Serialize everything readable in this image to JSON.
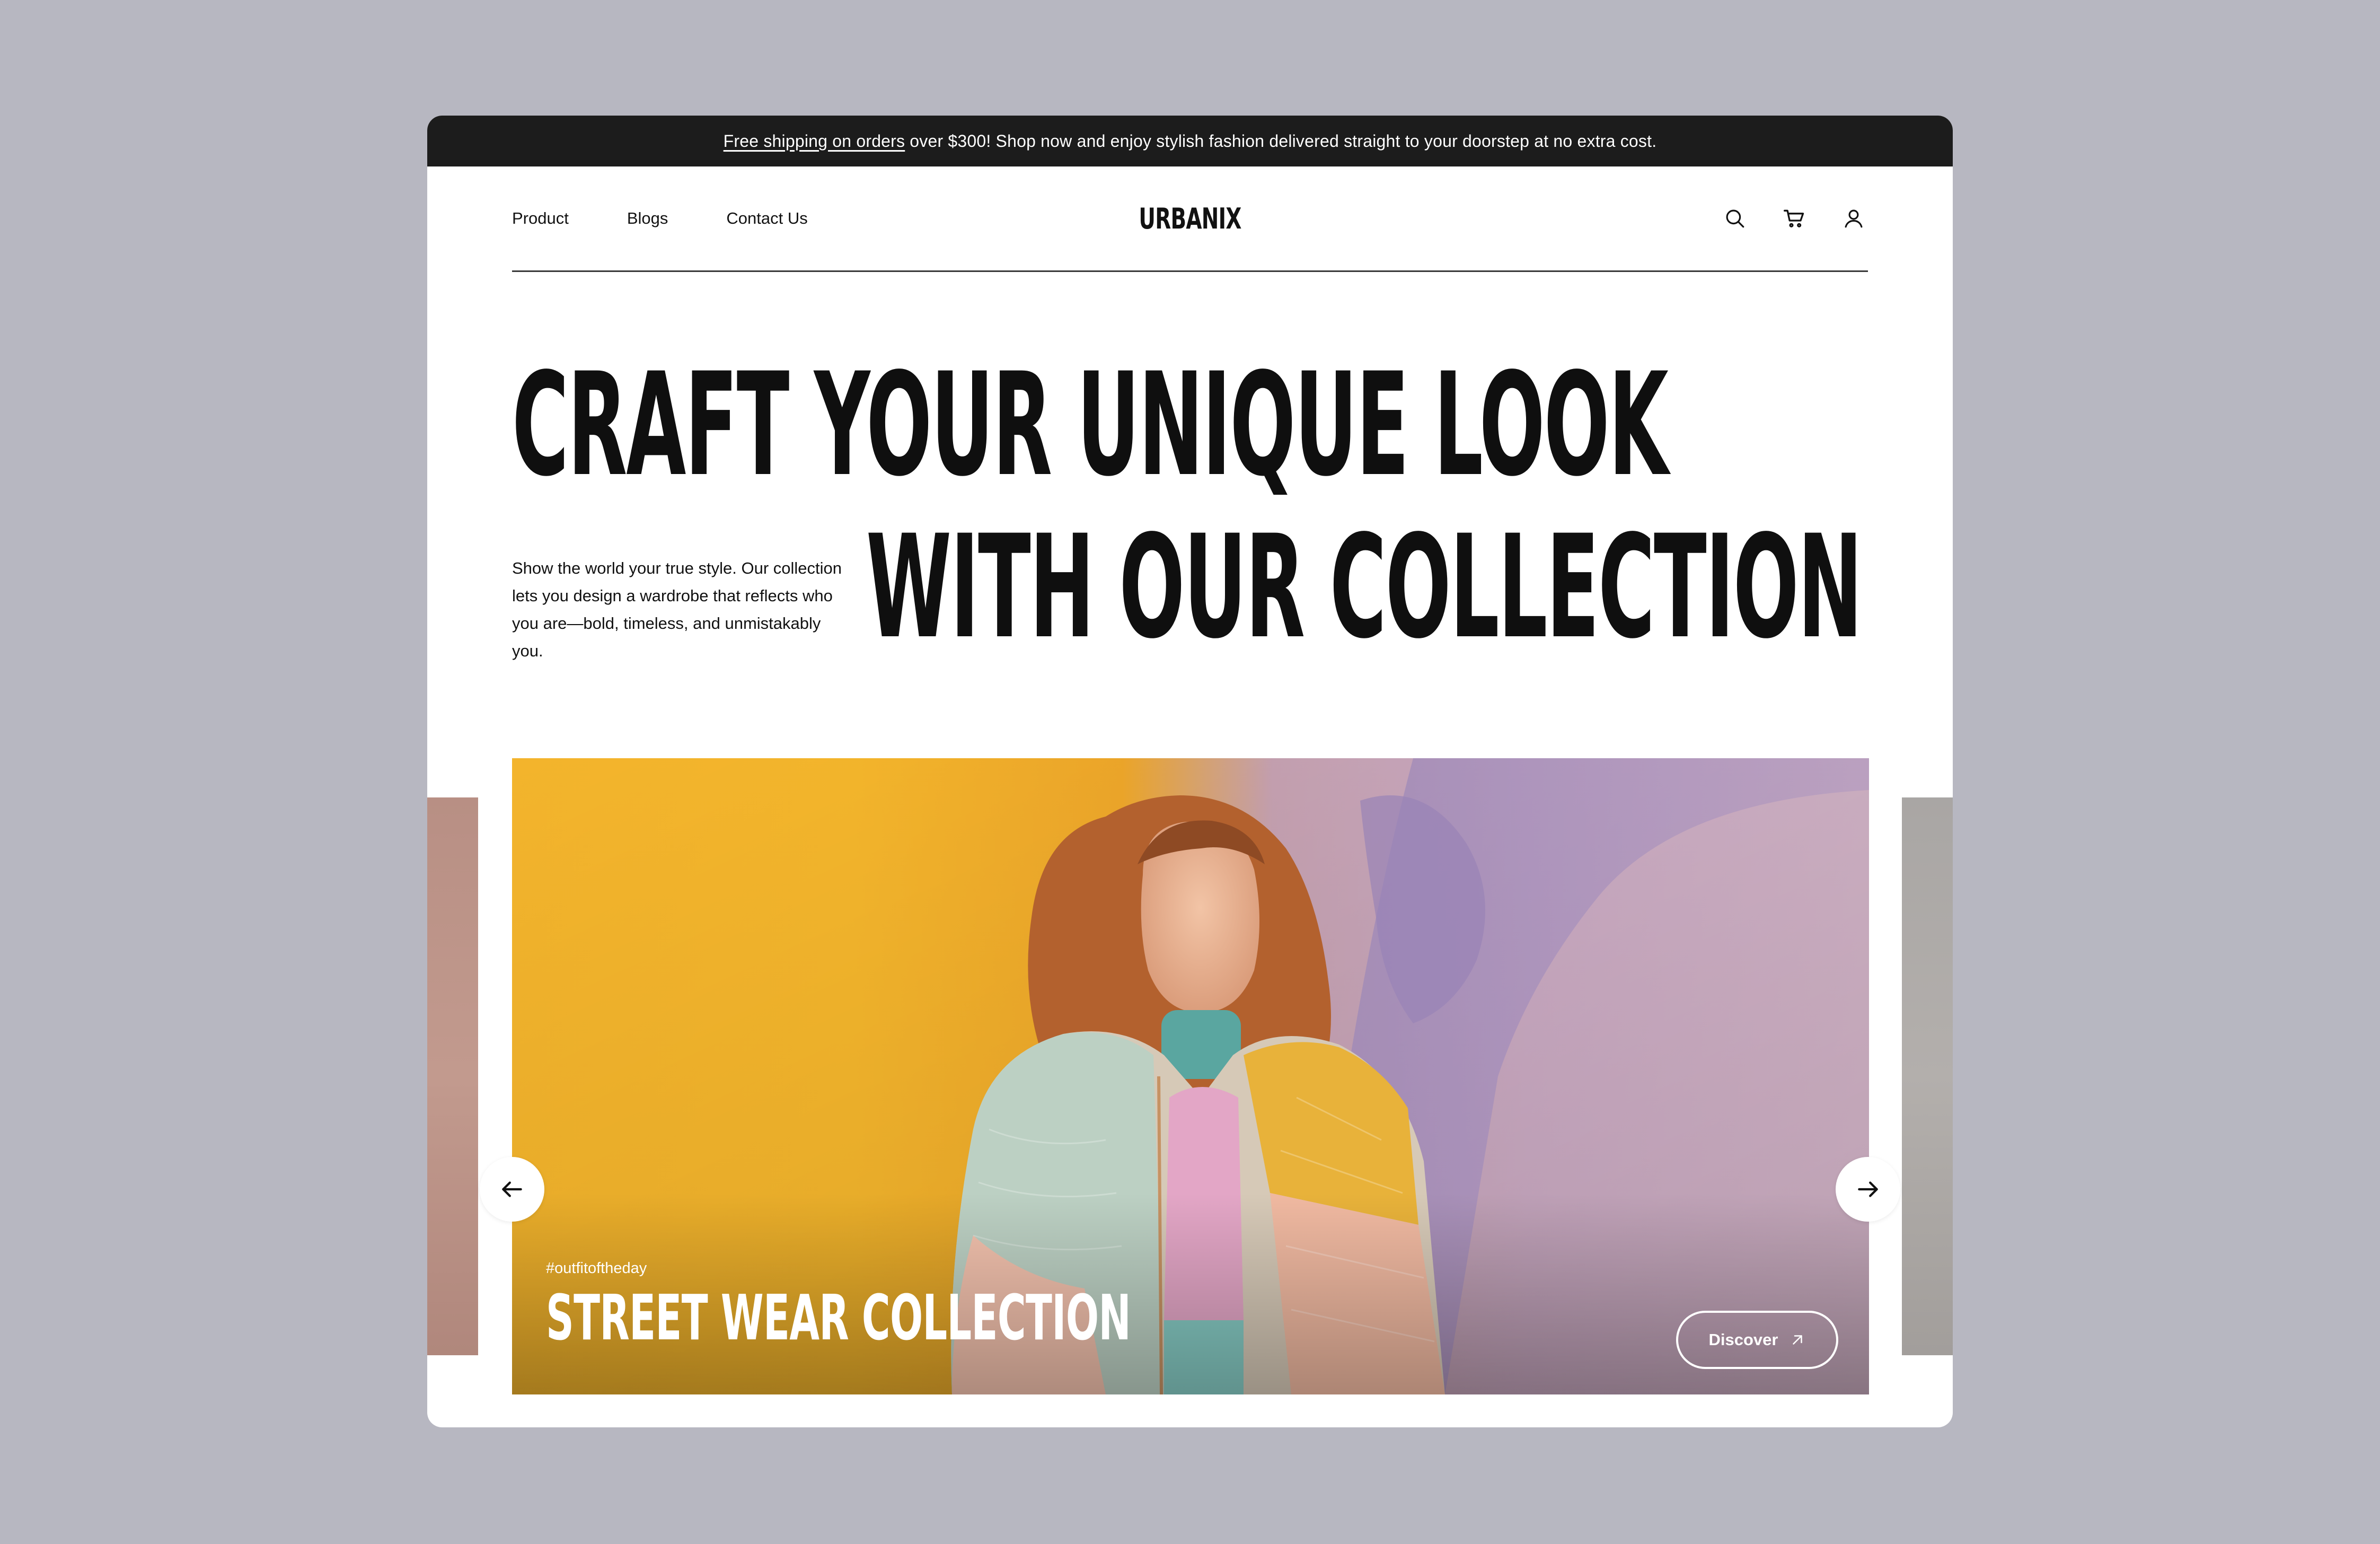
{
  "announcement": {
    "link_text": "Free shipping on orders",
    "rest_text": "over $300! Shop now and enjoy stylish fashion delivered straight to your doorstep at no extra cost."
  },
  "nav": {
    "links": [
      "Product",
      "Blogs",
      "Contact Us"
    ],
    "logo": "URBANIX",
    "icons": [
      "search-icon",
      "cart-icon",
      "user-icon"
    ]
  },
  "hero": {
    "line1": "CRAFT YOUR UNIQUE LOOK",
    "line2": "WITH OUR COLLECTION",
    "description": "Show the world your true style. Our collection lets you design a wardrobe that reflects who you are—bold, timeless, and unmistakably you."
  },
  "slider": {
    "hashtag": "#outfitoftheday",
    "title": "STREET WEAR COLLECTION",
    "discover_label": "Discover",
    "prev_icon": "arrow-left-icon",
    "next_icon": "arrow-right-icon"
  },
  "colors": {
    "background": "#b7b7c1",
    "announcement_bar": "#1c1c1c",
    "text": "#0f0f0f",
    "slide_yellow": "#f3b42c",
    "slide_lilac": "#cfaec7"
  }
}
